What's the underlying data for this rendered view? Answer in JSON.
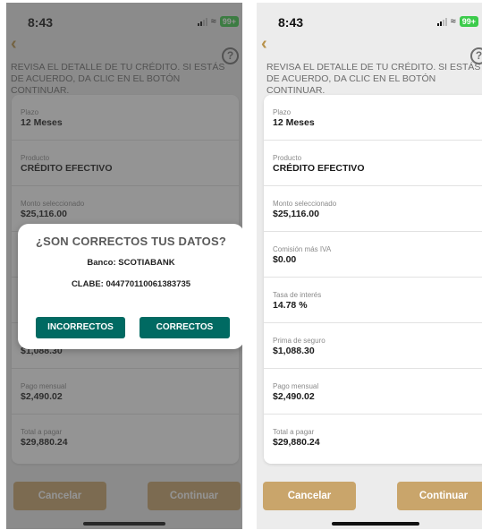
{
  "status": {
    "time": "8:43",
    "battery": "99+"
  },
  "header": {
    "back_icon": "chevron-left-icon",
    "help_glyph": "?",
    "instructions": "REVISA EL DETALLE DE TU CRÉDITO. SI ESTÁS DE ACUERDO, DA CLIC EN EL BOTÓN CONTINUAR."
  },
  "fields": [
    {
      "label": "Plazo",
      "value": "12 Meses"
    },
    {
      "label": "Producto",
      "value": "CRÉDITO EFECTIVO"
    },
    {
      "label": "Monto seleccionado",
      "value": "$25,116.00"
    },
    {
      "label": "Comisión más IVA",
      "value": "$0.00"
    },
    {
      "label": "Tasa de interés",
      "value": "14.78 %"
    },
    {
      "label": "Prima de seguro",
      "value": "$1,088.30"
    },
    {
      "label": "Pago mensual",
      "value": "$2,490.02"
    },
    {
      "label": "Total a pagar",
      "value": "$29,880.24"
    }
  ],
  "buttons": {
    "cancel": "Cancelar",
    "continue": "Continuar"
  },
  "dialog": {
    "title": "¿SON CORRECTOS TUS DATOS?",
    "bank": "Banco: SCOTIABANK",
    "clabe": "CLABE: 044770110061383735",
    "incorrect": "INCORRECTOS",
    "correct": "CORRECTOS"
  },
  "colors": {
    "accent": "#c9a56b",
    "dialog_button": "#006a62",
    "back": "#b8924a"
  }
}
